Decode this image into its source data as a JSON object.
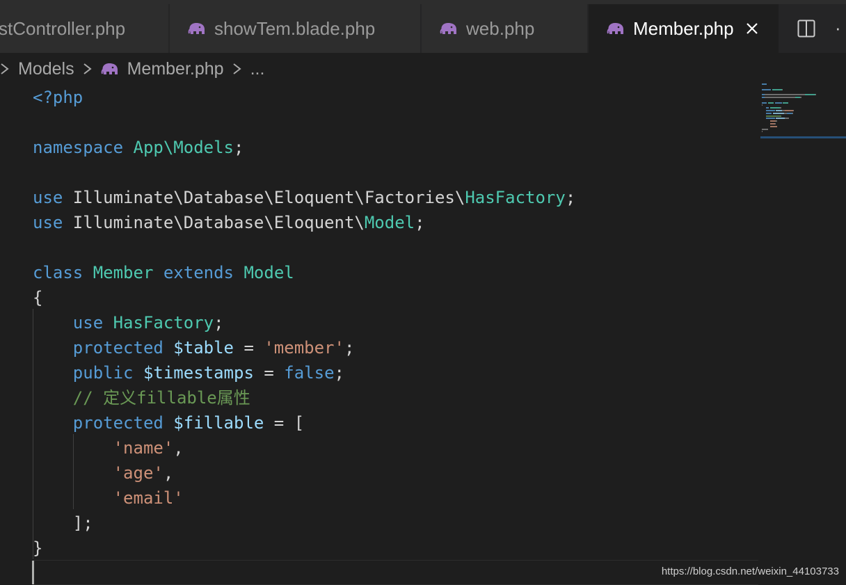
{
  "tabs": [
    {
      "label": "stController.php",
      "active": false,
      "icon": "php-elephant-icon"
    },
    {
      "label": "showTem.blade.php",
      "active": false,
      "icon": "php-elephant-icon"
    },
    {
      "label": "web.php",
      "active": false,
      "icon": "php-elephant-icon"
    },
    {
      "label": "Member.php",
      "active": true,
      "icon": "php-elephant-icon"
    }
  ],
  "breadcrumb": {
    "items": [
      "Models",
      "Member.php",
      "..."
    ],
    "separator": ">"
  },
  "code": {
    "lines": [
      [
        {
          "t": "<?php",
          "k": "kw"
        }
      ],
      [],
      [
        {
          "t": "namespace",
          "k": "kw"
        },
        {
          "t": " ",
          "k": "plain"
        },
        {
          "t": "App\\Models",
          "k": "cls"
        },
        {
          "t": ";",
          "k": "plain"
        }
      ],
      [],
      [
        {
          "t": "use",
          "k": "kw"
        },
        {
          "t": " Illuminate\\Database\\Eloquent\\Factories\\",
          "k": "plain"
        },
        {
          "t": "HasFactory",
          "k": "cls"
        },
        {
          "t": ";",
          "k": "plain"
        }
      ],
      [
        {
          "t": "use",
          "k": "kw"
        },
        {
          "t": " Illuminate\\Database\\Eloquent\\",
          "k": "plain"
        },
        {
          "t": "Model",
          "k": "cls"
        },
        {
          "t": ";",
          "k": "plain"
        }
      ],
      [],
      [
        {
          "t": "class",
          "k": "kw"
        },
        {
          "t": " ",
          "k": "plain"
        },
        {
          "t": "Member",
          "k": "cls"
        },
        {
          "t": " ",
          "k": "plain"
        },
        {
          "t": "extends",
          "k": "kw"
        },
        {
          "t": " ",
          "k": "plain"
        },
        {
          "t": "Model",
          "k": "cls"
        }
      ],
      [
        {
          "t": "{",
          "k": "plain"
        }
      ],
      [
        {
          "t": "    ",
          "k": "plain"
        },
        {
          "t": "use",
          "k": "kw"
        },
        {
          "t": " ",
          "k": "plain"
        },
        {
          "t": "HasFactory",
          "k": "cls"
        },
        {
          "t": ";",
          "k": "plain"
        }
      ],
      [
        {
          "t": "    ",
          "k": "plain"
        },
        {
          "t": "protected",
          "k": "kw"
        },
        {
          "t": " ",
          "k": "plain"
        },
        {
          "t": "$table",
          "k": "var"
        },
        {
          "t": " = ",
          "k": "plain"
        },
        {
          "t": "'member'",
          "k": "str"
        },
        {
          "t": ";",
          "k": "plain"
        }
      ],
      [
        {
          "t": "    ",
          "k": "plain"
        },
        {
          "t": "public",
          "k": "kw"
        },
        {
          "t": " ",
          "k": "plain"
        },
        {
          "t": "$timestamps",
          "k": "var"
        },
        {
          "t": " = ",
          "k": "plain"
        },
        {
          "t": "false",
          "k": "kw"
        },
        {
          "t": ";",
          "k": "plain"
        }
      ],
      [
        {
          "t": "    ",
          "k": "plain"
        },
        {
          "t": "// 定义fillable属性",
          "k": "com"
        }
      ],
      [
        {
          "t": "    ",
          "k": "plain"
        },
        {
          "t": "protected",
          "k": "kw"
        },
        {
          "t": " ",
          "k": "plain"
        },
        {
          "t": "$fillable",
          "k": "var"
        },
        {
          "t": " = [",
          "k": "plain"
        }
      ],
      [
        {
          "t": "        ",
          "k": "plain"
        },
        {
          "t": "'name'",
          "k": "str"
        },
        {
          "t": ",",
          "k": "plain"
        }
      ],
      [
        {
          "t": "        ",
          "k": "plain"
        },
        {
          "t": "'age'",
          "k": "str"
        },
        {
          "t": ",",
          "k": "plain"
        }
      ],
      [
        {
          "t": "        ",
          "k": "plain"
        },
        {
          "t": "'email'",
          "k": "str"
        }
      ],
      [
        {
          "t": "    ];",
          "k": "plain"
        }
      ],
      [
        {
          "t": "}",
          "k": "plain"
        }
      ],
      []
    ]
  },
  "watermark": "https://blog.csdn.net/weixin_44103733",
  "colors": {
    "background": "#1e1e1e",
    "keyword": "#569cd6",
    "class": "#4ec9b0",
    "variable": "#9cdcfe",
    "string": "#ce9178",
    "comment": "#6a9955",
    "plain": "#d4d4d4",
    "php_icon": "#a074c4"
  }
}
